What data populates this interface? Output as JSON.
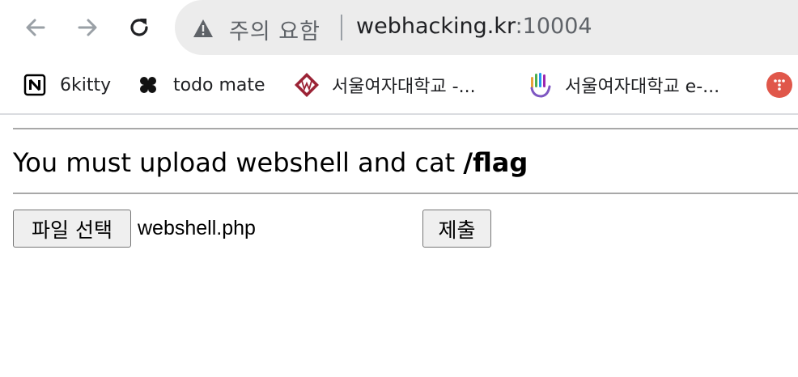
{
  "browser": {
    "address_bar": {
      "security_label": "주의 요함",
      "url_host": "webhacking.kr",
      "url_port": ":10004"
    },
    "bookmarks": [
      {
        "label": "6kitty",
        "icon": "notion-icon"
      },
      {
        "label": "todo mate",
        "icon": "clover-icon"
      },
      {
        "label": "서울여자대학교 -...",
        "icon": "swu-logo-icon"
      },
      {
        "label": "서울여자대학교 e-...",
        "icon": "hand-logo-icon"
      },
      {
        "label": "",
        "icon": "red-circle-icon"
      }
    ],
    "colors": {
      "omnibox_bg": "#ececec",
      "icon_gray": "#5f6368",
      "swu_red": "#9b2335",
      "red_circle": "#e0574a"
    }
  },
  "page": {
    "heading_text": "You must upload webshell and cat ",
    "heading_bold": "/flag",
    "form": {
      "file_button_label": "파일 선택",
      "file_name": "webshell.php",
      "submit_label": "제출"
    }
  }
}
